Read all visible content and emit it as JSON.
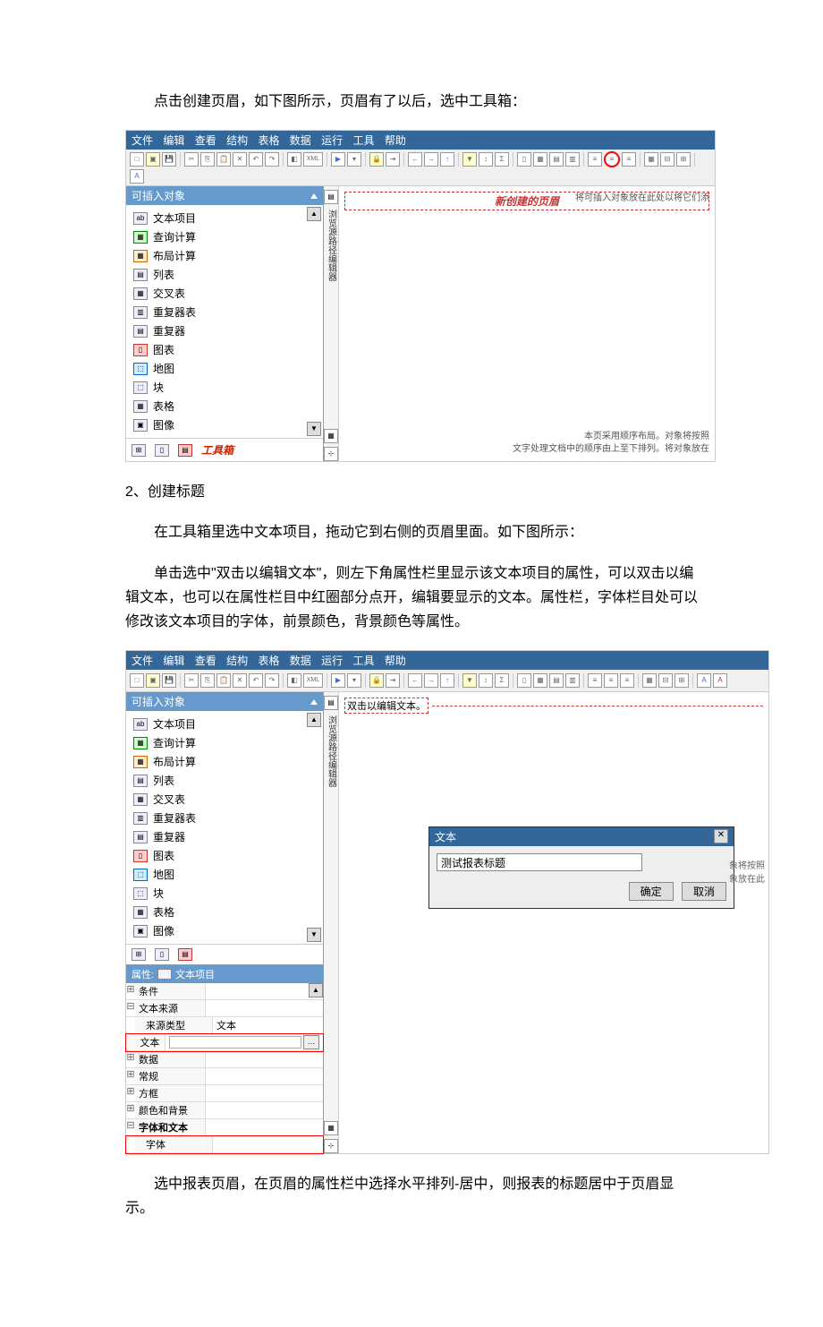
{
  "doc": {
    "p1": "点击创建页眉，如下图所示，页眉有了以后，选中工具箱：",
    "h2": "2、创建标题",
    "p2": "在工具箱里选中文本项目，拖动它到右侧的页眉里面。如下图所示：",
    "p3": "单击选中\"双击以编辑文本\"，则左下角属性栏里显示该文本项目的属性，可以双击以编辑文本，也可以在属性栏目中红圈部分点开，编辑要显示的文本。属性栏，字体栏目处可以修改该文本项目的字体，前景颜色，背景颜色等属性。",
    "p4": "选中报表页眉，在页眉的属性栏中选择水平排列-居中，则报表的标题居中于页眉显示。"
  },
  "menu": {
    "m1": "文件",
    "m2": "编辑",
    "m3": "查看",
    "m4": "结构",
    "m5": "表格",
    "m6": "数据",
    "m7": "运行",
    "m8": "工具",
    "m9": "帮助"
  },
  "shot1": {
    "sidebar_title": "可插入对象",
    "items": [
      "文本项目",
      "查询计算",
      "布局计算",
      "列表",
      "交叉表",
      "重复器表",
      "重复器",
      "图表",
      "地图",
      "块",
      "表格",
      "图像"
    ],
    "toolbox_label": "工具箱",
    "header_label": "新创建的页眉",
    "hint_right": "将可插入对象放在此处以将它们添",
    "bottom1": "本页采用顺序布局。对象将按照",
    "bottom2": "文字处理文档中的顺序由上至下排列。将对象放在",
    "vbar_text": "浏览源路径编辑器"
  },
  "shot2": {
    "sidebar_title": "可插入对象",
    "items": [
      "文本项目",
      "查询计算",
      "布局计算",
      "列表",
      "交叉表",
      "重复器表",
      "重复器",
      "图表",
      "地图",
      "块",
      "表格",
      "图像"
    ],
    "edit_placeholder": "双击以编辑文本。",
    "props_title": "属性: ",
    "props_obj": "文本项目",
    "prop_cond": "条件",
    "prop_src": "文本来源",
    "prop_srctype_k": "来源类型",
    "prop_srctype_v": "文本",
    "prop_text": "文本",
    "prop_data": "数据",
    "prop_general": "常规",
    "prop_box": "方框",
    "prop_color": "颜色和背景",
    "prop_font": "字体和文本",
    "prop_font_sub": "字体",
    "dialog_title": "文本",
    "dialog_value": "测试报表标题",
    "btn_ok": "确定",
    "btn_cancel": "取消",
    "side_note1": "象将按照",
    "side_note2": "象放在此",
    "vbar_text": "浏览源路径编辑器"
  }
}
